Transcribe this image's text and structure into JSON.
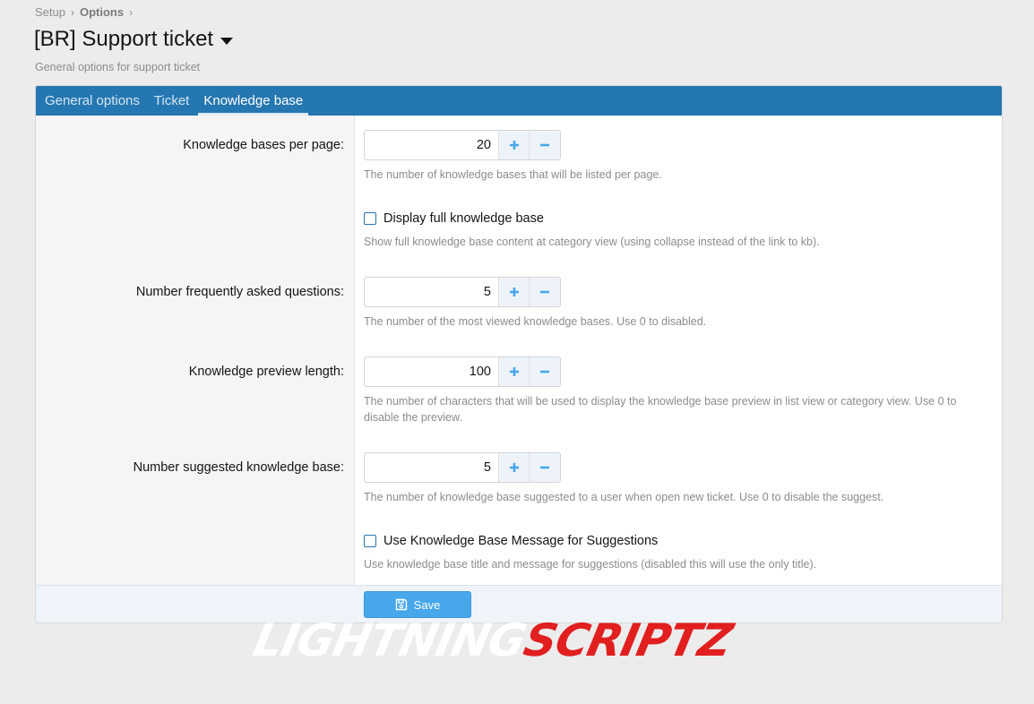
{
  "breadcrumb": {
    "items": [
      "Setup",
      "Options"
    ]
  },
  "page": {
    "title": "[BR] Support ticket",
    "description": "General options for support ticket"
  },
  "tabs": [
    {
      "label": "General options",
      "active": false
    },
    {
      "label": "Ticket",
      "active": false
    },
    {
      "label": "Knowledge base",
      "active": true
    }
  ],
  "options": {
    "per_page": {
      "label": "Knowledge bases per page:",
      "value": "20",
      "hint": "The number of knowledge bases that will be listed per page."
    },
    "display_full": {
      "label": "Display full knowledge base",
      "checked": false,
      "hint": "Show full knowledge base content at category view (using collapse instead of the link to kb)."
    },
    "faq_count": {
      "label": "Number frequently asked questions:",
      "value": "5",
      "hint": "The number of the most viewed knowledge bases. Use 0 to disabled."
    },
    "preview_length": {
      "label": "Knowledge preview length:",
      "value": "100",
      "hint": "The number of characters that will be used to display the knowledge base preview in list view or category view. Use 0 to disable the preview."
    },
    "suggested_count": {
      "label": "Number suggested knowledge base:",
      "value": "5",
      "hint": "The number of knowledge base suggested to a user when open new ticket. Use 0 to disable the suggest."
    },
    "use_message": {
      "label": "Use Knowledge Base Message for Suggestions",
      "checked": false,
      "hint": "Use knowledge base title and message for suggestions (disabled this will use the only title)."
    }
  },
  "footer": {
    "save_label": "Save"
  },
  "watermark": {
    "part1": "LIGHTNING",
    "part2": "SCRIPTZ"
  },
  "colors": {
    "accent": "#2577b1",
    "save": "#47a7eb",
    "watermark_red": "#e11f1f"
  },
  "icons": {
    "plus": "plus-icon",
    "minus": "minus-icon",
    "save": "save-icon",
    "caret": "caret-down-icon",
    "separator": "chevron-right-icon"
  }
}
